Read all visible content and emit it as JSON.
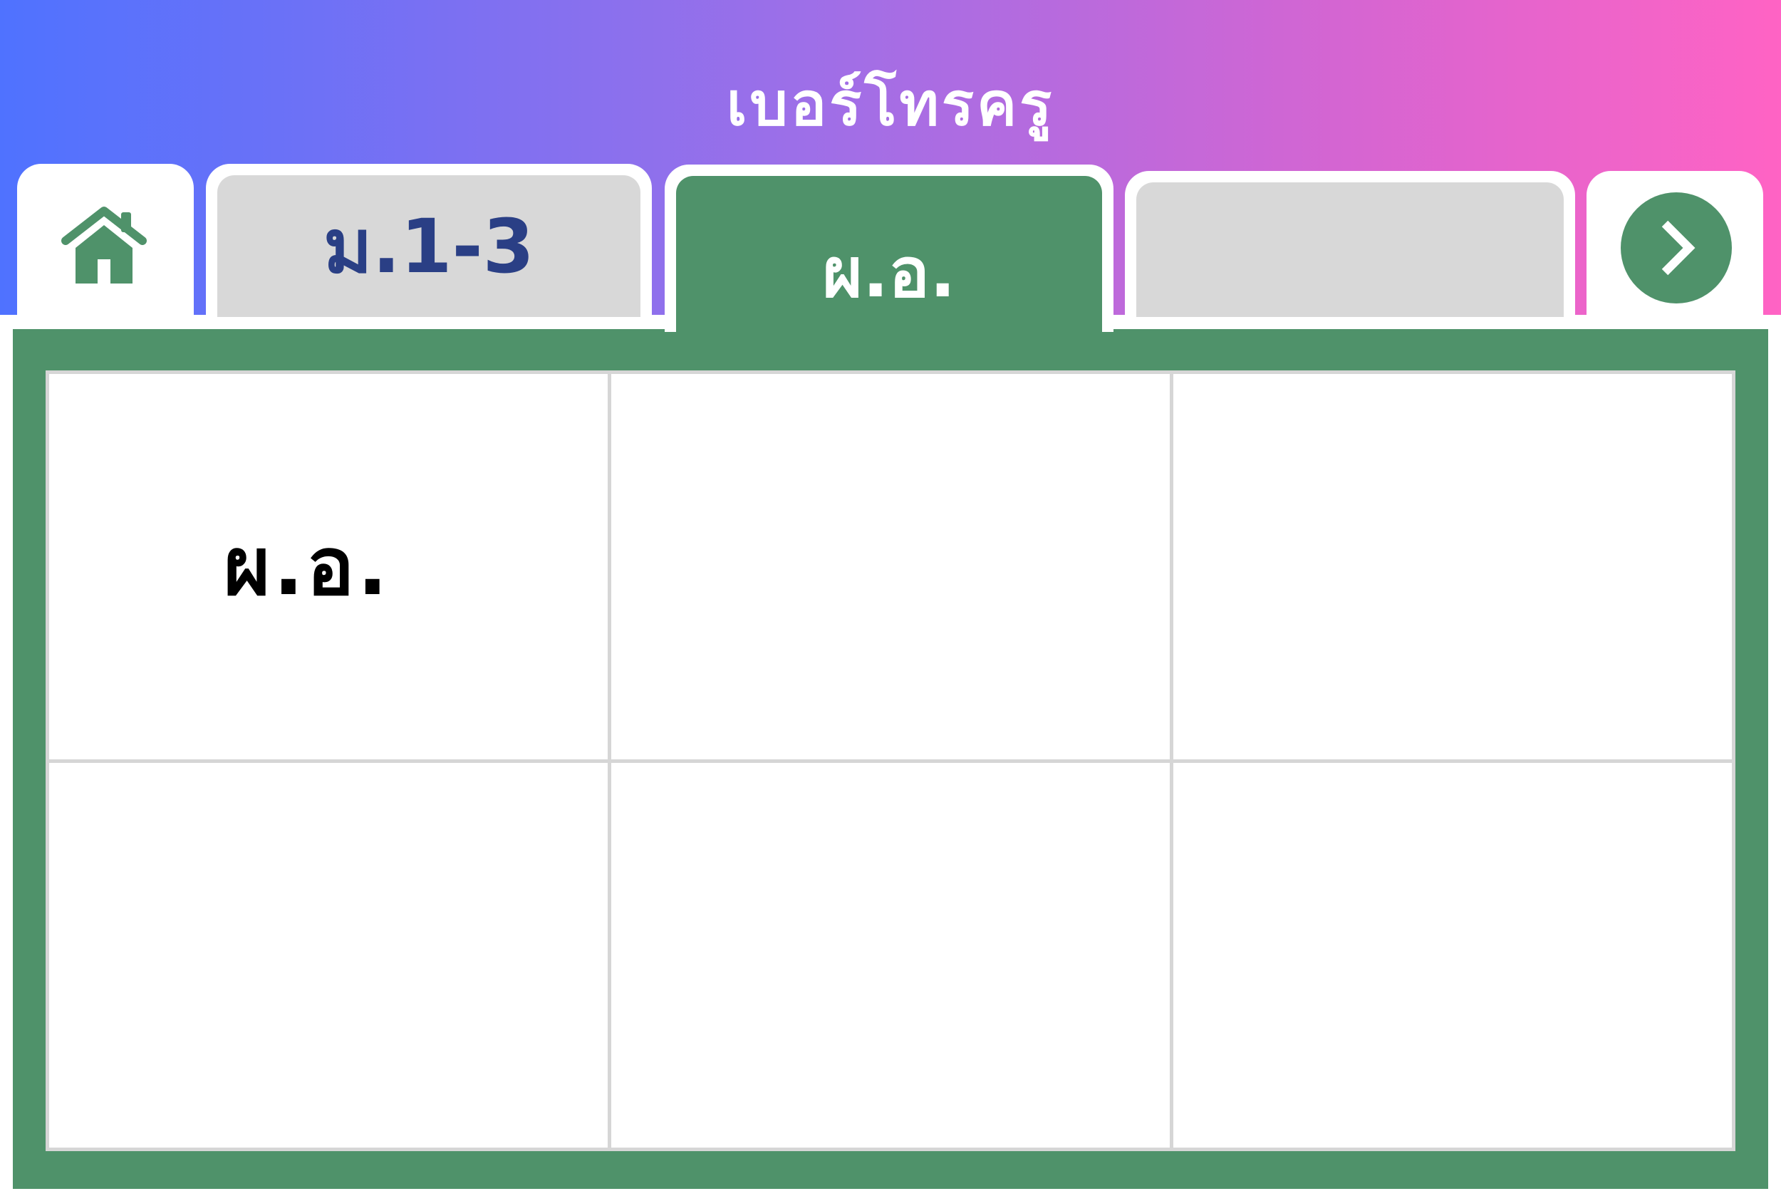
{
  "header": {
    "title": "เบอร์โทรครู"
  },
  "tabs": {
    "home_icon": "home-icon",
    "m13_label": "ม.1-3",
    "active_label": "ผ.อ.",
    "blank_label": "",
    "next_icon": "chevron-right-icon"
  },
  "grid": {
    "cells": [
      "ผ.อ.",
      "",
      "",
      "",
      "",
      ""
    ]
  },
  "colors": {
    "accent_green": "#4f926a",
    "tab_gray": "#d8d8d8",
    "tab_text_blue": "#2a3f85",
    "gradient_start": "#4f72ff",
    "gradient_end": "#ff63c4"
  }
}
